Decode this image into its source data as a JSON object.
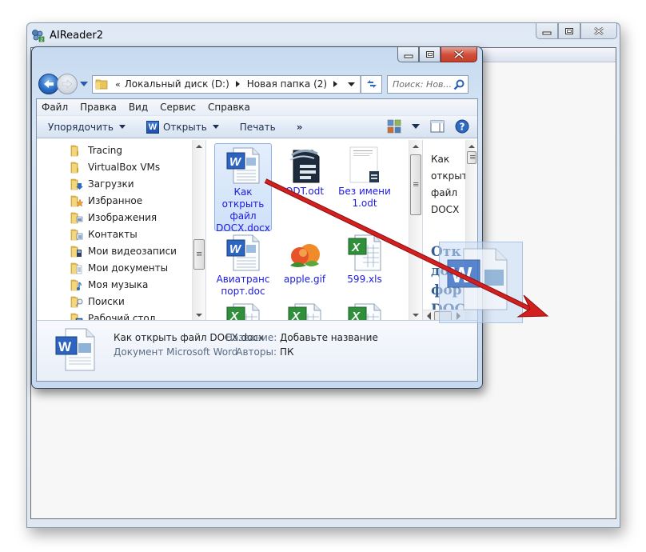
{
  "outer_window": {
    "title": "AIReader2",
    "controls": {
      "minimize": "minimize",
      "maximize": "maximize",
      "close": "close"
    }
  },
  "explorer": {
    "address": {
      "overflow": "«",
      "crumbs": [
        "Локальный диск (D:)",
        "Новая папка (2)"
      ]
    },
    "search_placeholder": "Поиск: Нов...",
    "menu": [
      "Файл",
      "Правка",
      "Вид",
      "Сервис",
      "Справка"
    ],
    "commands": {
      "organize": "Упорядочить",
      "open": "Открыть",
      "print": "Печать",
      "more": "»"
    },
    "tree": [
      {
        "label": "Tracing",
        "icon": "folder-icon"
      },
      {
        "label": "VirtualBox VMs",
        "icon": "folder-icon"
      },
      {
        "label": "Загрузки",
        "icon": "downloads-folder-icon"
      },
      {
        "label": "Избранное",
        "icon": "favorites-folder-icon"
      },
      {
        "label": "Изображения",
        "icon": "pictures-folder-icon"
      },
      {
        "label": "Контакты",
        "icon": "contacts-folder-icon"
      },
      {
        "label": "Мои видеозаписи",
        "icon": "videos-folder-icon"
      },
      {
        "label": "Мои документы",
        "icon": "documents-folder-icon"
      },
      {
        "label": "Моя музыка",
        "icon": "music-folder-icon"
      },
      {
        "label": "Поиски",
        "icon": "searches-folder-icon"
      },
      {
        "label": "Рабочий стол",
        "icon": "desktop-folder-icon"
      }
    ],
    "files": [
      {
        "name": "Как открыть файл DOCX.docx",
        "lines": [
          "Как",
          "открыть",
          "файл",
          "DOCX.docx"
        ],
        "type": "word",
        "selected": true
      },
      {
        "name": "ODT.odt",
        "lines": [
          "ODT.odt"
        ],
        "type": "odt",
        "selected": false
      },
      {
        "name": "Без имени 1.odt",
        "lines": [
          "Без имени",
          "1.odt"
        ],
        "type": "odt-doc",
        "selected": false
      },
      {
        "name": "Авиатранспорт.doc",
        "lines": [
          "Авиатранс",
          "порт.doc"
        ],
        "type": "word",
        "selected": false
      },
      {
        "name": "apple.gif",
        "lines": [
          "apple.gif"
        ],
        "type": "image",
        "selected": false
      },
      {
        "name": "599.xls",
        "lines": [
          "599.xls"
        ],
        "type": "excel",
        "selected": false
      },
      {
        "name": "",
        "lines": [],
        "type": "excel",
        "selected": false
      },
      {
        "name": "",
        "lines": [],
        "type": "excel",
        "selected": false
      },
      {
        "name": "",
        "lines": [],
        "type": "excel",
        "selected": false
      }
    ],
    "preview": {
      "lines": [
        "Как",
        "открыт",
        "файл",
        "DOCX"
      ],
      "heading_lines": [
        "Отк",
        "док",
        "фор",
        "DOC"
      ]
    },
    "details": {
      "filename": "Как открыть файл DOCX.docx",
      "filetype": "Документ Microsoft Word",
      "props": [
        {
          "key": "Название:",
          "value": "Добавьте название"
        },
        {
          "key": "Авторы:",
          "value": "ПК"
        }
      ]
    }
  },
  "colors": {
    "link_blue": "#1a1ae0",
    "arrow_red": "#d31f1f",
    "close_red": "#c53f2a",
    "preview_heading": "#365f91"
  }
}
